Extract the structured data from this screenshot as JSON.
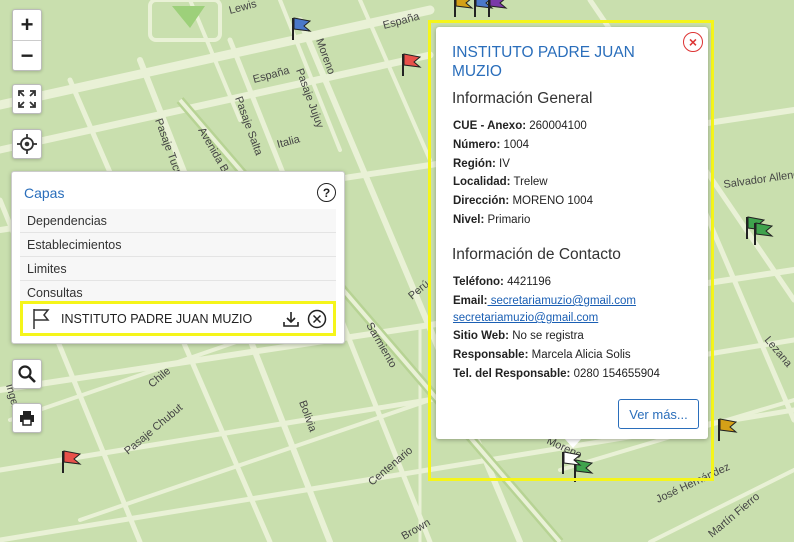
{
  "map": {
    "streets": [
      "España",
      "España",
      "Lewis",
      "Moreno",
      "Pasaje Jujuy",
      "Pasaje Salta",
      "Pasaje Tucumán",
      "Avenida Belgrano",
      "Italia",
      "Salvador Allende",
      "Chile",
      "Pasaje Chubut",
      "Bolivia",
      "Centenario",
      "Sarmiento",
      "Moreno",
      "José Hernández",
      "Martín Fierro",
      "Lezana",
      "Brown",
      "Perú",
      "Ingeniero"
    ]
  },
  "controls": {
    "zoom_in": "+",
    "zoom_out": "−",
    "fullscreen_icon": "expand-icon",
    "locate_icon": "crosshair-icon",
    "search_icon": "search-icon",
    "print_icon": "printer-icon"
  },
  "layers": {
    "title": "Capas",
    "help": "?",
    "items": [
      "Dependencias",
      "Establecimientos",
      "Limites",
      "Consultas"
    ],
    "active": {
      "name": "INSTITUTO PADRE JUAN MUZIO",
      "download_icon": "download-icon",
      "remove_icon": "close-circle-icon"
    }
  },
  "popup": {
    "title": "INSTITUTO PADRE JUAN MUZIO",
    "close": "×",
    "general_title": "Información General",
    "general": {
      "cue_label": "CUE - Anexo:",
      "cue_value": " 260004100",
      "numero_label": "Número:",
      "numero_value": " 1004",
      "region_label": "Región:",
      "region_value": " IV",
      "localidad_label": "Localidad:",
      "localidad_value": " Trelew",
      "direccion_label": "Dirección:",
      "direccion_value": " MORENO 1004",
      "nivel_label": "Nivel:",
      "nivel_value": " Primario"
    },
    "contact_title": "Información de Contacto",
    "contact": {
      "telefono_label": "Teléfono:",
      "telefono_value": " 4421196",
      "email_label": "Email:",
      "email_1": " secretariamuzio@gmail.com",
      "email_2": "secretariamuzio@gmail.com",
      "web_label": "Sitio Web:",
      "web_value": " No se registra",
      "responsable_label": "Responsable:",
      "responsable_value": " Marcela Alicia Solis",
      "tel_resp_label": "Tel. del Responsable:",
      "tel_resp_value": " 0280 154655904"
    },
    "more_button": "Ver más..."
  },
  "colors": {
    "map_bg": "#c9dfae",
    "road": "#e9f1d6",
    "accent": "#2a6ebb",
    "highlight": "#f5f51a",
    "flag_red": "#e8514a",
    "flag_green": "#3fa34d",
    "flag_blue": "#4a78c9",
    "flag_gold": "#d4a017",
    "flag_purple": "#7a3aa8"
  }
}
